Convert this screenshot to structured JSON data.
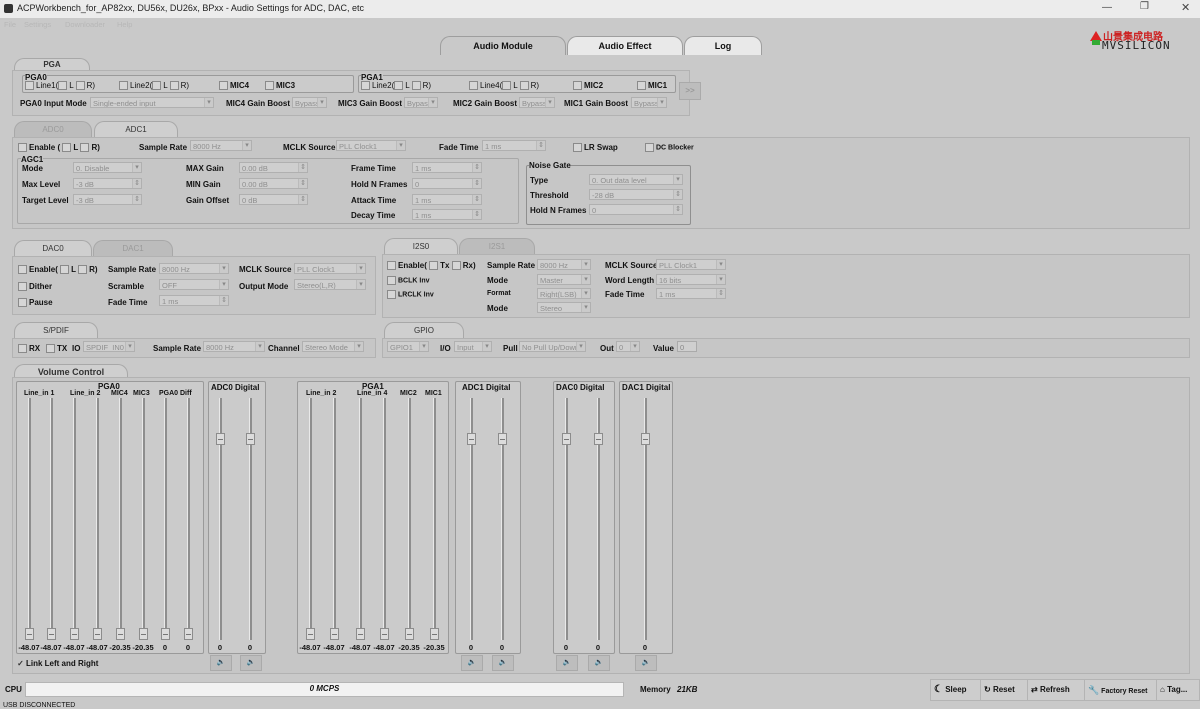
{
  "window": {
    "title": "ACPWorkbench_for_AP82xx, DU56x, DU26x, BPxx - Audio Settings for ADC, DAC, etc",
    "controls": [
      "minimize-icon",
      "restore-icon",
      "close-icon"
    ]
  },
  "menu": [
    "File",
    "Settings",
    "Downloader",
    "Help"
  ],
  "main_tabs": [
    {
      "label": "Audio Module",
      "active": true
    },
    {
      "label": "Audio Effect",
      "active": false
    },
    {
      "label": "Log",
      "active": false
    }
  ],
  "logo": {
    "cn": "山景集成电路",
    "en": "MVSILICON"
  },
  "pga": {
    "section": "PGA",
    "pga0": {
      "label": "PGA0",
      "line1": "Line1(",
      "line2": "Line2(",
      "l": "L",
      "r": "R)",
      "mic4": "MIC4",
      "mic3": "MIC3"
    },
    "pga1": {
      "label": "PGA1",
      "line2": "Line2(",
      "line4": "Line4(",
      "l": "L",
      "r": "R)",
      "mic2": "MIC2",
      "mic1": "MIC1"
    },
    "input_mode_label": "PGA0 Input Mode",
    "input_mode": "Single-ended input",
    "mic4_boost_label": "MIC4 Gain Boost",
    "mic3_boost_label": "MIC3 Gain Boost",
    "mic2_boost_label": "MIC2 Gain Boost",
    "mic1_boost_label": "MIC1 Gain Boost",
    "boost_value": "Bypass",
    "arrow": ">>"
  },
  "adc": {
    "tabs": [
      "ADC0",
      "ADC1"
    ],
    "enable": "Enable (",
    "l": "L",
    "r": "R)",
    "sample_rate_label": "Sample Rate",
    "sample_rate": "8000 Hz",
    "mclk_label": "MCLK Source",
    "mclk": "PLL Clock1",
    "fade_label": "Fade Time",
    "fade": "1 ms",
    "lr_swap": "LR Swap",
    "dc_blocker": "DC Blocker",
    "agc": {
      "title": "AGC1",
      "mode_label": "Mode",
      "mode": "0. Disable",
      "max_level_label": "Max Level",
      "max_level": "-3 dB",
      "target_label": "Target Level",
      "target": "-3 dB",
      "max_gain_label": "MAX Gain",
      "max_gain": "0.00 dB",
      "min_gain_label": "MIN Gain",
      "min_gain": "0.00 dB",
      "offset_label": "Gain Offset",
      "offset": "0 dB",
      "frame_time_label": "Frame Time",
      "frame_time": "1 ms",
      "hold_label": "Hold N Frames",
      "hold": "0",
      "attack_label": "Attack Time",
      "attack": "1 ms",
      "decay_label": "Decay Time",
      "decay": "1 ms"
    },
    "noise_gate": {
      "title": "Noise Gate",
      "type_label": "Type",
      "type": "0. Out data level",
      "threshold_label": "Threshold",
      "threshold": "-28 dB",
      "hold_label": "Hold N Frames",
      "hold": "0"
    }
  },
  "dac": {
    "tabs": [
      "DAC0",
      "DAC1"
    ],
    "enable": "Enable(",
    "l": "L",
    "r": "R)",
    "dither": "Dither",
    "pause": "Pause",
    "sample_rate_label": "Sample Rate",
    "sample_rate": "8000 Hz",
    "scramble_label": "Scramble",
    "scramble": "OFF",
    "fade_label": "Fade Time",
    "fade": "1 ms",
    "mclk_label": "MCLK Source",
    "mclk": "PLL Clock1",
    "output_label": "Output Mode",
    "output": "Stereo(L,R)"
  },
  "i2s": {
    "tabs": [
      "I2S0",
      "I2S1"
    ],
    "enable": "Enable(",
    "tx": "Tx",
    "rx": "Rx)",
    "bclk": "BCLK Inv",
    "lrclk": "LRCLK Inv",
    "sample_rate_label": "Sample Rate",
    "sample_rate": "8000 Hz",
    "mode_label": "Mode",
    "mode": "Master",
    "format_label": "Format",
    "format": "Right(LSB)",
    "mode2_label": "Mode",
    "mode2": "Stereo",
    "mclk_label": "MCLK Source",
    "mclk": "PLL Clock1",
    "word_label": "Word Length",
    "word": "16 bits",
    "fade_label": "Fade Time",
    "fade": "1 ms"
  },
  "spdif": {
    "tab": "S/PDIF",
    "rx": "RX",
    "tx": "TX",
    "io_label": "IO",
    "io": "SPDIF_IN0",
    "sample_rate_label": "Sample Rate",
    "sample_rate": "8000 Hz",
    "channel_label": "Channel",
    "channel": "Stereo Mode"
  },
  "gpio": {
    "tab": "GPIO",
    "port": "GPIO1",
    "io_label": "I/O",
    "io": "Input",
    "pull_label": "Pull",
    "pull": "No Pull Up/Down",
    "out_label": "Out",
    "out": "0",
    "value_label": "Value",
    "value": "0"
  },
  "volume": {
    "title": "Volume Control",
    "pga0": {
      "title": "PGA0",
      "labels": [
        "Line_in 1",
        "Line_in 2",
        "MIC4",
        "MIC3",
        "PGA0 Diff"
      ],
      "values": [
        "-48.07",
        "-48.07",
        "-48.07",
        "-48.07",
        "-20.35",
        "-20.35",
        "0",
        "0"
      ],
      "levels": [
        0,
        0,
        0,
        0,
        0,
        0,
        0,
        0
      ]
    },
    "adc0": {
      "title": "ADC0 Digital",
      "values": [
        "0",
        "0"
      ],
      "levels": [
        0.85,
        0.85
      ]
    },
    "pga1": {
      "title": "PGA1",
      "labels": [
        "Line_in 2",
        "Line_in 4",
        "MIC2",
        "MIC1"
      ],
      "values": [
        "-48.07",
        "-48.07",
        "-48.07",
        "-48.07",
        "-20.35",
        "-20.35"
      ],
      "levels": [
        0,
        0,
        0,
        0,
        0,
        0
      ]
    },
    "adc1": {
      "title": "ADC1 Digital",
      "values": [
        "0",
        "0"
      ],
      "levels": [
        0.85,
        0.85
      ]
    },
    "dac0": {
      "title": "DAC0 Digital",
      "values": [
        "0",
        "0"
      ],
      "levels": [
        0.85,
        0.85
      ]
    },
    "dac1": {
      "title": "DAC1 Digital",
      "values": [
        "0"
      ],
      "levels": [
        0.85
      ]
    },
    "link": "Link Left and Right"
  },
  "status": {
    "cpu_label": "CPU",
    "mcps": "0 MCPS",
    "memory_label": "Memory",
    "memory": "21KB",
    "connection": "USB DISCONNECTED"
  },
  "buttons": {
    "sleep": "Sleep",
    "reset": "Reset",
    "refresh": "Refresh",
    "factory": "Factory Reset",
    "tag": "Tag..."
  }
}
